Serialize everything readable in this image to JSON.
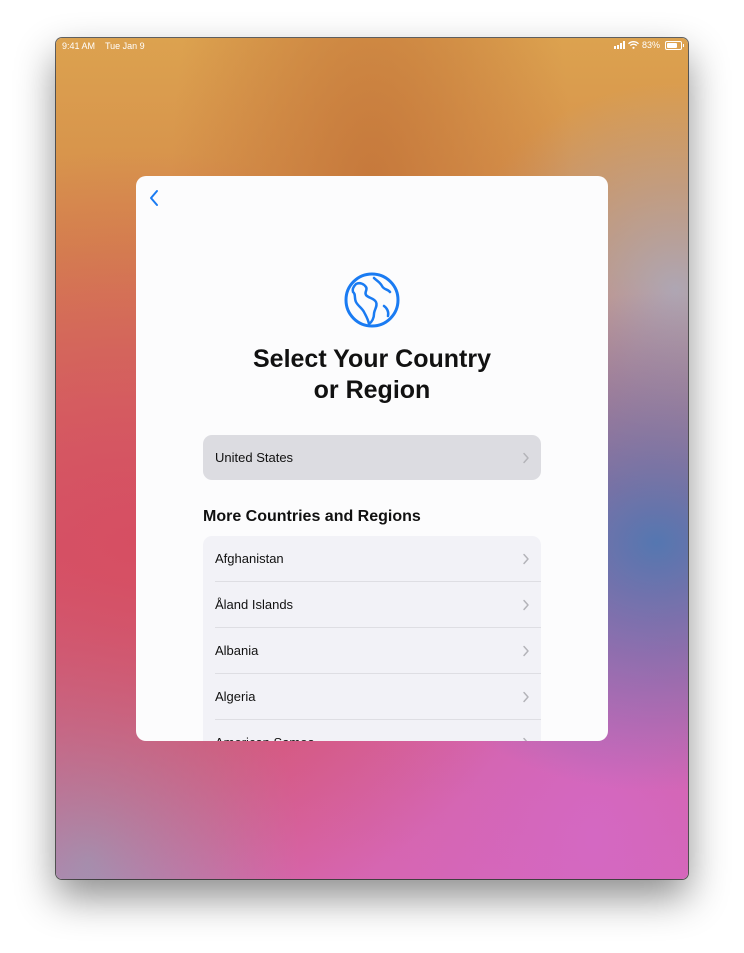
{
  "status_bar": {
    "time": "9:41 AM",
    "date": "Tue Jan 9",
    "battery": "83%"
  },
  "icons": {
    "back": "chevron-left-icon",
    "globe": "globe-americas-icon",
    "row_chevron": "chevron-right-icon"
  },
  "colors": {
    "accent": "#1a7bf2",
    "selected_row": "#dcdce1",
    "list_background": "#f2f2f7"
  },
  "sheet": {
    "title_line1": "Select Your Country",
    "title_line2": "or Region",
    "selected_country": "United States",
    "section_header": "More Countries and Regions",
    "countries": [
      {
        "label": "Afghanistan"
      },
      {
        "label": "Åland Islands"
      },
      {
        "label": "Albania"
      },
      {
        "label": "Algeria"
      },
      {
        "label": "American Samoa"
      }
    ]
  }
}
